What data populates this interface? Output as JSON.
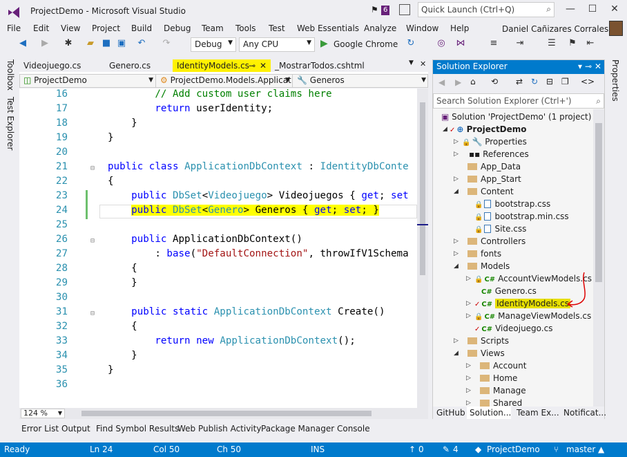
{
  "window": {
    "title": "ProjectDemo - Microsoft Visual Studio",
    "notification_count": "6",
    "quick_launch_placeholder": "Quick Launch (Ctrl+Q)",
    "user": "Daniel Cañizares Corrales"
  },
  "menu": [
    "File",
    "Edit",
    "View",
    "Project",
    "Build",
    "Debug",
    "Team",
    "Tools",
    "Test",
    "Web Essentials",
    "Analyze",
    "Window",
    "Help"
  ],
  "toolbar": {
    "config": "Debug",
    "platform": "Any CPU",
    "browser": "Google Chrome"
  },
  "left_tools": [
    "Toolbox",
    "Test Explorer"
  ],
  "right_tools": [
    "Properties"
  ],
  "tabs": [
    "Videojuego.cs",
    "Genero.cs",
    "IdentityModels.cs",
    "_MostrarTodos.cshtml"
  ],
  "nav": {
    "project": "ProjectDemo",
    "class": "ProjectDemo.Models.Applicat",
    "member": "Generos"
  },
  "code_lines": [
    {
      "n": "16"
    },
    {
      "n": "17"
    },
    {
      "n": "18"
    },
    {
      "n": "19"
    },
    {
      "n": "20"
    },
    {
      "n": "21"
    },
    {
      "n": "22"
    },
    {
      "n": "23"
    },
    {
      "n": "24"
    },
    {
      "n": "25"
    },
    {
      "n": "26"
    },
    {
      "n": "27"
    },
    {
      "n": "28"
    },
    {
      "n": "29"
    },
    {
      "n": "30"
    },
    {
      "n": "31"
    },
    {
      "n": "32"
    },
    {
      "n": "33"
    },
    {
      "n": "34"
    },
    {
      "n": "35"
    },
    {
      "n": "36"
    }
  ],
  "zoom": "124 %",
  "solution_explorer": {
    "title": "Solution Explorer",
    "search_placeholder": "Search Solution Explorer (Ctrl+')",
    "items": [
      "Solution 'ProjectDemo' (1 project)",
      "ProjectDemo",
      "Properties",
      "References",
      "App_Data",
      "App_Start",
      "Content",
      "bootstrap.css",
      "bootstrap.min.css",
      "Site.css",
      "Controllers",
      "fonts",
      "Models",
      "AccountViewModels.cs",
      "Genero.cs",
      "IdentityModels.cs",
      "ManageViewModels.cs",
      "Videojuego.cs",
      "Scripts",
      "Views",
      "Account",
      "Home",
      "Manage",
      "Shared"
    ],
    "tabs": [
      "GitHub",
      "Solution...",
      "Team Ex...",
      "Notificat..."
    ]
  },
  "bottom_tabs": [
    "Error List",
    "Output",
    "Find Symbol Results",
    "Web Publish Activity",
    "Package Manager Console"
  ],
  "status": {
    "state": "Ready",
    "line": "Ln 24",
    "col": "Col 50",
    "ch": "Ch 50",
    "mode": "INS",
    "up": "0",
    "changes": "4",
    "repo": "ProjectDemo",
    "branch": "master"
  },
  "colors": {
    "accent": "#007acc",
    "highlight": "#ffff00",
    "keyword": "#0000ff",
    "type": "#2b91af",
    "comment": "#008000",
    "string": "#a31515"
  }
}
